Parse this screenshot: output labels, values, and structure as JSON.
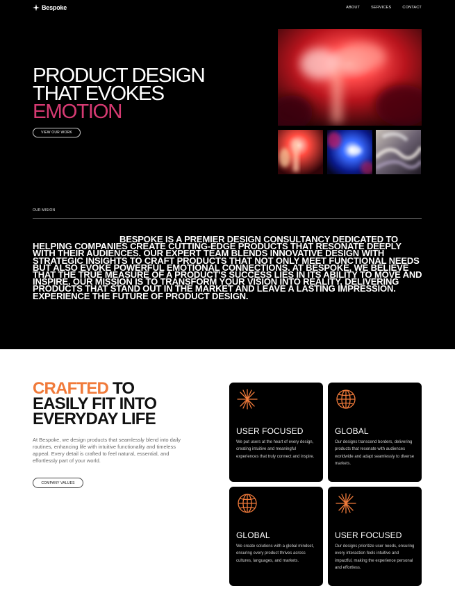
{
  "nav": {
    "logo": "Bespoke",
    "links": [
      "ABOUT",
      "SERVICES",
      "CONTACT"
    ]
  },
  "hero": {
    "title_lines": [
      "PRODUCT DESIGN",
      "THAT EVOKES",
      "EMOTION"
    ],
    "cta": "VIEW OUR WORK"
  },
  "mission": {
    "label": "OUR MISION",
    "text": "Bespoke is a premier design consultancy dedicated to helping companies create cutting-edge products that resonate deeply with their audiences. Our expert team blends innovative design with strategic insights to craft products that not only meet functional needs but also evoke powerful emotional connections. At Bespoke, we believe that the true measure of a product's success lies in its ability to move and inspire. Our mission is to transform your vision into reality, delivering products that stand out in the market and leave a lasting impression. Experience the future of product design."
  },
  "values": {
    "title_accent": "CRAFTED",
    "title_rest_1": "TO",
    "title_line_2": "EASILY FIT INTO",
    "title_line_3": "EVERYDAY LIFE",
    "description": "At Bespoke, we design products that seamlessly blend into daily routines, enhancing life with intuitive functionality and timeless appeal. Every detail is crafted to feel natural, essential, and effortlessly part of your world.",
    "cta": "COMPANY VALUES",
    "cards": [
      {
        "icon": "starburst-icon",
        "title": "USER FOCUSED",
        "text": "We put users at the heart of every design, creating intuitive and meaningful experiences that truly connect and inspire."
      },
      {
        "icon": "globe-icon",
        "title": "GLOBAL",
        "text": "Our designs transcend borders, delivering products that resonate with audiences worldwide and adapt seamlessly to diverse markets."
      },
      {
        "icon": "globe-icon",
        "title": "GLOBAL",
        "text": "We create solutions with a global mindset, ensuring every product thrives across cultures, languages, and markets."
      },
      {
        "icon": "starburst-icon",
        "title": "USER FOCUSED",
        "text": "Our designs prioritize user needs, ensuring every interaction feels intuitive and impactful, making the experience personal and effortless."
      }
    ]
  },
  "colors": {
    "accent_pink": "#d63a72",
    "accent_orange": "#f07a3a",
    "background_dark": "#000000",
    "background_light": "#ffffff"
  }
}
